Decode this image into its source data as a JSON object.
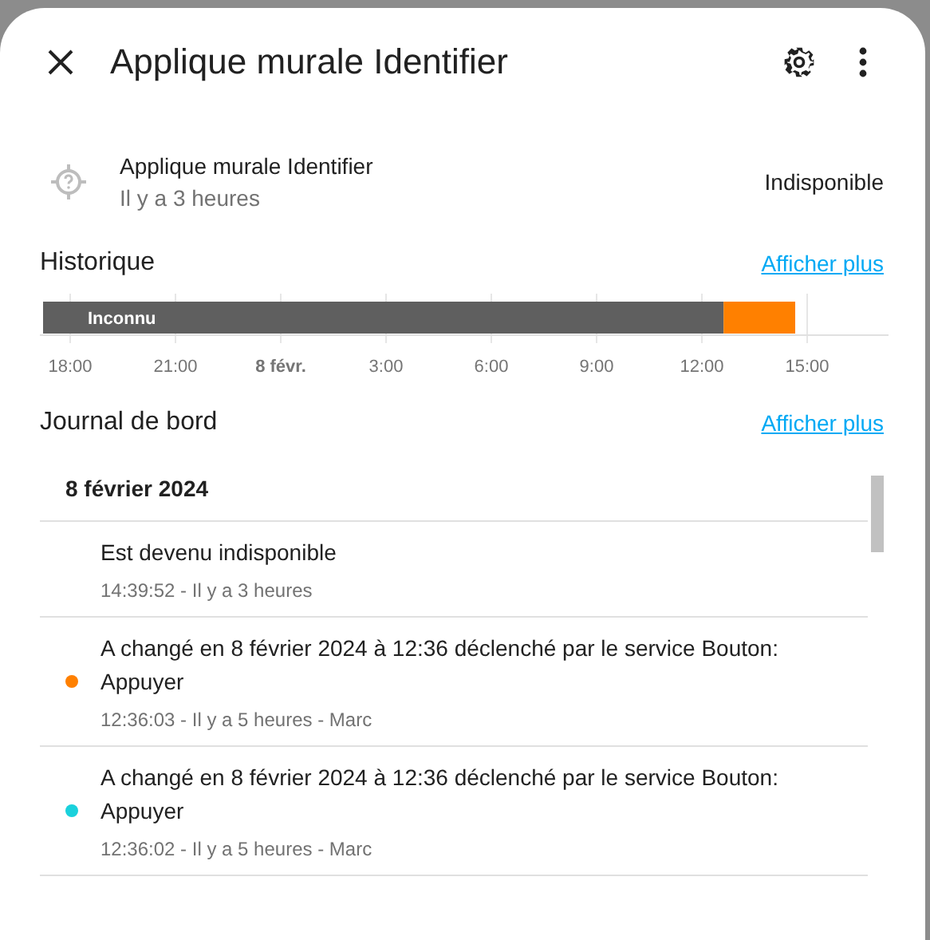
{
  "header": {
    "title": "Applique murale Identifier"
  },
  "entity": {
    "name": "Applique murale Identifier",
    "time": "Il y a 3 heures",
    "state": "Indisponible"
  },
  "history": {
    "title": "Historique",
    "link": "Afficher plus",
    "timeline": {
      "segments": [
        {
          "label": "Inconnu",
          "color": "#5f5f5f"
        },
        {
          "color": "#ff8000"
        }
      ],
      "ticks": [
        {
          "label": "18:00",
          "bold": false
        },
        {
          "label": "21:00",
          "bold": false
        },
        {
          "label": "8 févr.",
          "bold": true
        },
        {
          "label": "3:00",
          "bold": false
        },
        {
          "label": "6:00",
          "bold": false
        },
        {
          "label": "9:00",
          "bold": false
        },
        {
          "label": "12:00",
          "bold": false
        },
        {
          "label": "15:00",
          "bold": false
        }
      ]
    }
  },
  "logbook": {
    "title": "Journal de bord",
    "link": "Afficher plus",
    "date": "8 février 2024",
    "entries": [
      {
        "message": "Est devenu indisponible",
        "meta": "14:39:52 - Il y a 3 heures"
      },
      {
        "message": "A changé en 8 février 2024 à 12:36 déclenché par le service Bouton: Appuyer",
        "meta": "12:36:03 - Il y a 5 heures - Marc",
        "color": "#ff8000"
      },
      {
        "message": "A changé en 8 février 2024 à 12:36 déclenché par le service Bouton: Appuyer",
        "meta": "12:36:02 - Il y a 5 heures - Marc",
        "color": "#1ad1dc"
      }
    ]
  }
}
